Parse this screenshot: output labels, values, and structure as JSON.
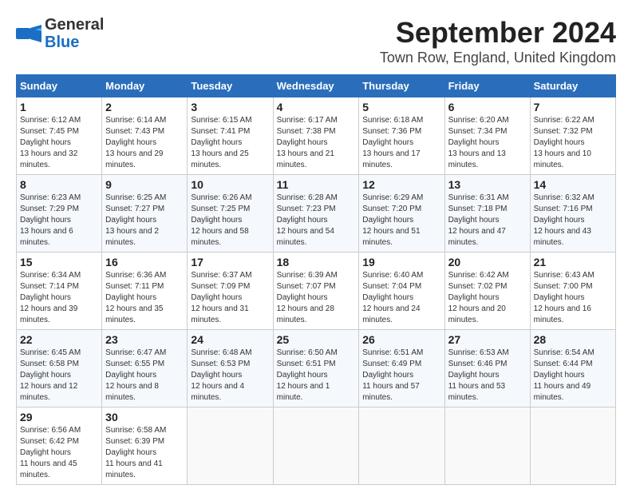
{
  "logo": {
    "line1": "General",
    "line2": "Blue"
  },
  "title": "September 2024",
  "subtitle": "Town Row, England, United Kingdom",
  "headers": [
    "Sunday",
    "Monday",
    "Tuesday",
    "Wednesday",
    "Thursday",
    "Friday",
    "Saturday"
  ],
  "weeks": [
    [
      {
        "day": "1",
        "sunrise": "6:12 AM",
        "sunset": "7:45 PM",
        "daylight": "13 hours and 32 minutes."
      },
      {
        "day": "2",
        "sunrise": "6:14 AM",
        "sunset": "7:43 PM",
        "daylight": "13 hours and 29 minutes."
      },
      {
        "day": "3",
        "sunrise": "6:15 AM",
        "sunset": "7:41 PM",
        "daylight": "13 hours and 25 minutes."
      },
      {
        "day": "4",
        "sunrise": "6:17 AM",
        "sunset": "7:38 PM",
        "daylight": "13 hours and 21 minutes."
      },
      {
        "day": "5",
        "sunrise": "6:18 AM",
        "sunset": "7:36 PM",
        "daylight": "13 hours and 17 minutes."
      },
      {
        "day": "6",
        "sunrise": "6:20 AM",
        "sunset": "7:34 PM",
        "daylight": "13 hours and 13 minutes."
      },
      {
        "day": "7",
        "sunrise": "6:22 AM",
        "sunset": "7:32 PM",
        "daylight": "13 hours and 10 minutes."
      }
    ],
    [
      {
        "day": "8",
        "sunrise": "6:23 AM",
        "sunset": "7:29 PM",
        "daylight": "13 hours and 6 minutes."
      },
      {
        "day": "9",
        "sunrise": "6:25 AM",
        "sunset": "7:27 PM",
        "daylight": "13 hours and 2 minutes."
      },
      {
        "day": "10",
        "sunrise": "6:26 AM",
        "sunset": "7:25 PM",
        "daylight": "12 hours and 58 minutes."
      },
      {
        "day": "11",
        "sunrise": "6:28 AM",
        "sunset": "7:23 PM",
        "daylight": "12 hours and 54 minutes."
      },
      {
        "day": "12",
        "sunrise": "6:29 AM",
        "sunset": "7:20 PM",
        "daylight": "12 hours and 51 minutes."
      },
      {
        "day": "13",
        "sunrise": "6:31 AM",
        "sunset": "7:18 PM",
        "daylight": "12 hours and 47 minutes."
      },
      {
        "day": "14",
        "sunrise": "6:32 AM",
        "sunset": "7:16 PM",
        "daylight": "12 hours and 43 minutes."
      }
    ],
    [
      {
        "day": "15",
        "sunrise": "6:34 AM",
        "sunset": "7:14 PM",
        "daylight": "12 hours and 39 minutes."
      },
      {
        "day": "16",
        "sunrise": "6:36 AM",
        "sunset": "7:11 PM",
        "daylight": "12 hours and 35 minutes."
      },
      {
        "day": "17",
        "sunrise": "6:37 AM",
        "sunset": "7:09 PM",
        "daylight": "12 hours and 31 minutes."
      },
      {
        "day": "18",
        "sunrise": "6:39 AM",
        "sunset": "7:07 PM",
        "daylight": "12 hours and 28 minutes."
      },
      {
        "day": "19",
        "sunrise": "6:40 AM",
        "sunset": "7:04 PM",
        "daylight": "12 hours and 24 minutes."
      },
      {
        "day": "20",
        "sunrise": "6:42 AM",
        "sunset": "7:02 PM",
        "daylight": "12 hours and 20 minutes."
      },
      {
        "day": "21",
        "sunrise": "6:43 AM",
        "sunset": "7:00 PM",
        "daylight": "12 hours and 16 minutes."
      }
    ],
    [
      {
        "day": "22",
        "sunrise": "6:45 AM",
        "sunset": "6:58 PM",
        "daylight": "12 hours and 12 minutes."
      },
      {
        "day": "23",
        "sunrise": "6:47 AM",
        "sunset": "6:55 PM",
        "daylight": "12 hours and 8 minutes."
      },
      {
        "day": "24",
        "sunrise": "6:48 AM",
        "sunset": "6:53 PM",
        "daylight": "12 hours and 4 minutes."
      },
      {
        "day": "25",
        "sunrise": "6:50 AM",
        "sunset": "6:51 PM",
        "daylight": "12 hours and 1 minute."
      },
      {
        "day": "26",
        "sunrise": "6:51 AM",
        "sunset": "6:49 PM",
        "daylight": "11 hours and 57 minutes."
      },
      {
        "day": "27",
        "sunrise": "6:53 AM",
        "sunset": "6:46 PM",
        "daylight": "11 hours and 53 minutes."
      },
      {
        "day": "28",
        "sunrise": "6:54 AM",
        "sunset": "6:44 PM",
        "daylight": "11 hours and 49 minutes."
      }
    ],
    [
      {
        "day": "29",
        "sunrise": "6:56 AM",
        "sunset": "6:42 PM",
        "daylight": "11 hours and 45 minutes."
      },
      {
        "day": "30",
        "sunrise": "6:58 AM",
        "sunset": "6:39 PM",
        "daylight": "11 hours and 41 minutes."
      },
      null,
      null,
      null,
      null,
      null
    ]
  ]
}
